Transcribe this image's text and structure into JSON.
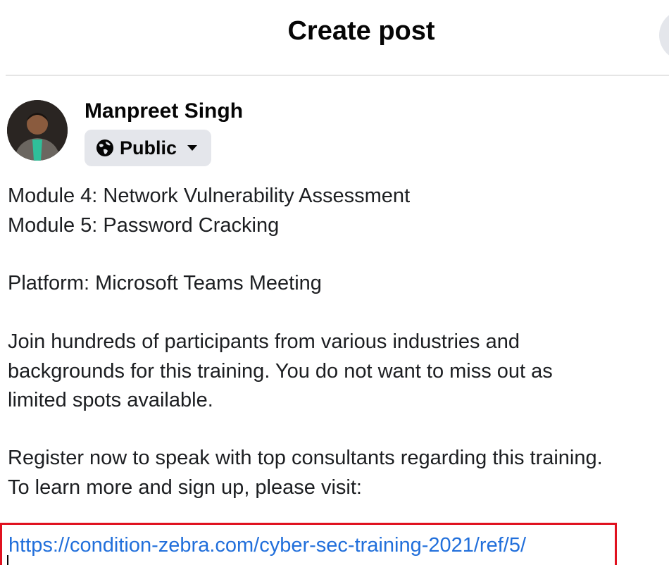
{
  "header": {
    "title": "Create post"
  },
  "author": {
    "name": "Manpreet Singh",
    "audience": "Public",
    "audience_icon": "globe-icon",
    "audience_dropdown_icon": "caret-down-icon"
  },
  "post": {
    "lines": [
      "Module 4: Network Vulnerability Assessment",
      "Module 5: Password Cracking",
      "Platform: Microsoft Teams Meeting",
      "Join hundreds of participants from various industries and",
      "backgrounds for this training. You do not want to miss out as",
      "limited spots available.",
      "Register now to speak with top consultants regarding this training.",
      "To learn more and sign up, please visit:"
    ],
    "link": "https://condition-zebra.com/cyber-sec-training-2021/ref/5/"
  },
  "colors": {
    "link": "#216fdb",
    "highlight_box": "#e0111f",
    "button_bg": "#e4e6eb"
  }
}
